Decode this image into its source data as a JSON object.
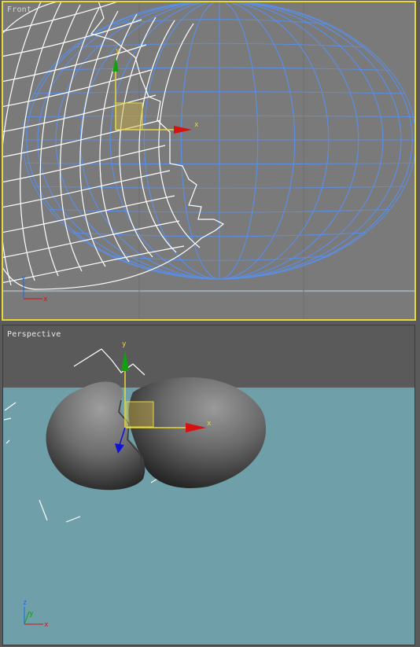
{
  "viewports": {
    "front": {
      "label": "Front",
      "active": true
    },
    "perspective": {
      "label": "Perspective",
      "active": false
    }
  },
  "gizmo": {
    "x_label": "x",
    "y_label": "y"
  },
  "axis_tripod": {
    "front": {
      "x": "x",
      "y": "y"
    },
    "perspective": {
      "x": "x",
      "y": "y",
      "z": "z"
    }
  },
  "colors": {
    "active_border": "#e8d83a",
    "front_bg": "#7a7a7a",
    "ground": "#6f9fa9",
    "sky": "#5a5a5a",
    "blue_wire": "#5b8ee6",
    "white_wire": "#ffffff",
    "axis_x": "#d81010",
    "axis_y": "#10a010",
    "axis_z": "#1010d8"
  }
}
